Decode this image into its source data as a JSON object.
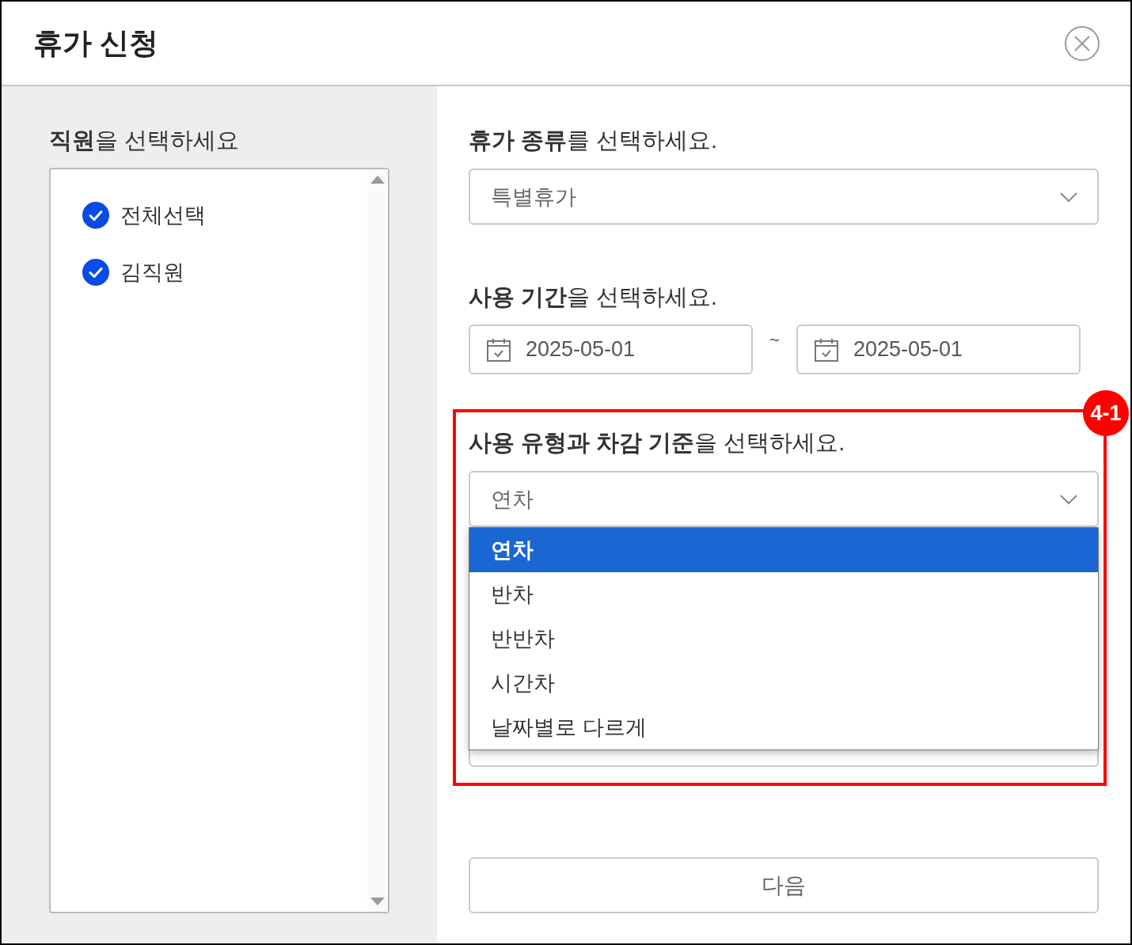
{
  "window": {
    "title": "휴가 신청"
  },
  "employees": {
    "title": "**직원**을 선택하세요",
    "items": [
      {
        "label": "전체선택",
        "checked": true
      },
      {
        "label": "김직원",
        "checked": true
      }
    ]
  },
  "leave_type": {
    "title": "**휴가 종류**를 선택하세요.",
    "value": "특별휴가"
  },
  "period": {
    "title": "**사용 기간**을 선택하세요.",
    "start": "2025-05-01",
    "separator": "~",
    "end": "2025-05-01"
  },
  "usage": {
    "badge": "4-1",
    "title": "**사용 유형과 차감 기준**을 선택하세요.",
    "value": "연차",
    "expanded": true,
    "options": [
      {
        "label": "연차",
        "selected": true
      },
      {
        "label": "반차",
        "selected": false
      },
      {
        "label": "반반차",
        "selected": false
      },
      {
        "label": "시간차",
        "selected": false
      },
      {
        "label": "날짜별로 다르게",
        "selected": false
      }
    ]
  },
  "next_button": "다음"
}
